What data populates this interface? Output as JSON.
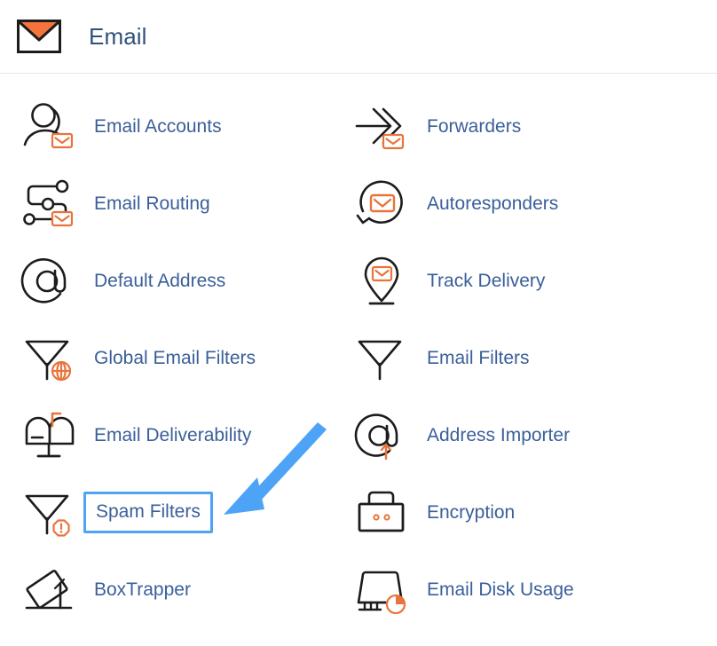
{
  "header": {
    "title": "Email",
    "icon": "envelope-icon"
  },
  "colors": {
    "link": "#3a5f99",
    "title": "#31517d",
    "icon_outline": "#1c1c1c",
    "icon_accent": "#e8743b",
    "highlight": "#4da3f5",
    "divider": "#e6e6e6",
    "background": "#ffffff"
  },
  "annotation": {
    "arrow": "blue-arrow-pointing-to-spam-filters",
    "target": "Spam Filters"
  },
  "grid": {
    "rows": [
      {
        "left": {
          "label": "Email Accounts",
          "icon": "user-with-envelope-icon",
          "highlighted": false
        },
        "right": {
          "label": "Forwarders",
          "icon": "arrow-forward-envelope-icon",
          "highlighted": false
        }
      },
      {
        "left": {
          "label": "Email Routing",
          "icon": "routing-nodes-envelope-icon",
          "highlighted": false
        },
        "right": {
          "label": "Autoresponders",
          "icon": "circular-arrow-envelope-icon",
          "highlighted": false
        }
      },
      {
        "left": {
          "label": "Default Address",
          "icon": "at-sign-circle-icon",
          "highlighted": false
        },
        "right": {
          "label": "Track Delivery",
          "icon": "map-pin-envelope-icon",
          "highlighted": false
        }
      },
      {
        "left": {
          "label": "Global Email Filters",
          "icon": "funnel-globe-icon",
          "highlighted": false
        },
        "right": {
          "label": "Email Filters",
          "icon": "funnel-icon",
          "highlighted": false
        }
      },
      {
        "left": {
          "label": "Email Deliverability",
          "icon": "mailbox-flag-icon",
          "highlighted": false
        },
        "right": {
          "label": "Address Importer",
          "icon": "at-sign-upload-icon",
          "highlighted": false
        }
      },
      {
        "left": {
          "label": "Spam Filters",
          "icon": "funnel-alert-icon",
          "highlighted": true
        },
        "right": {
          "label": "Encryption",
          "icon": "padlock-icon",
          "highlighted": false
        }
      },
      {
        "left": {
          "label": "BoxTrapper",
          "icon": "box-trap-icon",
          "highlighted": false
        },
        "right": {
          "label": "Email Disk Usage",
          "icon": "disk-pie-icon",
          "highlighted": false
        }
      }
    ]
  }
}
